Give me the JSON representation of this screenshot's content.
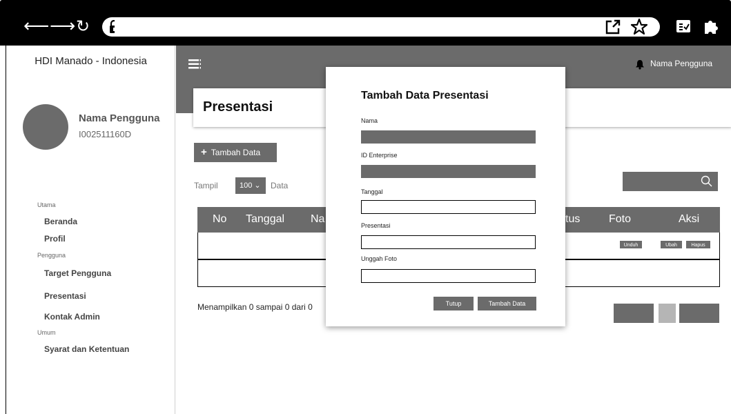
{
  "browser": {
    "icons": [
      "back-arrow-icon",
      "forward-arrow-icon",
      "reload-icon",
      "lock-icon",
      "open-external-icon",
      "star-icon",
      "reader-icon",
      "extension-icon"
    ],
    "back": "⟵",
    "forward": "⟶",
    "reload": "↻"
  },
  "sidebar": {
    "brand": "HDI Manado - Indonesia",
    "user_name": "Nama Pengguna",
    "user_id": "I002511160D",
    "sections": {
      "utama": "Utama",
      "pengguna": "Pengguna",
      "umum": "Umum"
    },
    "items": {
      "beranda": "Beranda",
      "profil": "Profil",
      "target": "Target Pengguna",
      "presentasi": "Presentasi",
      "kontak": "Kontak Admin",
      "syarat": "Syarat dan Ketentuan"
    }
  },
  "header": {
    "user": "Nama Pengguna"
  },
  "page": {
    "title": "Presentasi",
    "add_plus": "+",
    "add_label": "Tambah Data",
    "show_label": "Tampil",
    "show_value": "100 ⌄",
    "data_label": "Data",
    "footer": "Menampilkan 0 sampai 0 dari 0"
  },
  "table": {
    "headers": {
      "no": "No",
      "tanggal": "Tanggal",
      "nama": "Na",
      "status": "tus",
      "foto": "Foto",
      "aksi": "Aksi"
    },
    "row_buttons": {
      "unduh": "Unduh",
      "ubah": "Ubah",
      "hapus": "Hapus"
    }
  },
  "modal": {
    "title": "Tambah Data Presentasi",
    "fields": {
      "nama": "Nama",
      "id": "ID Enterprise",
      "tanggal": "Tanggal",
      "presentasi": "Presentasi",
      "foto": "Unggah Foto"
    },
    "close": "Tutup",
    "submit": "Tambah Data"
  },
  "colors": {
    "chrome": "#000000",
    "accent_gray": "#6b6b6b",
    "pagination_active": "#b5b5b5"
  }
}
